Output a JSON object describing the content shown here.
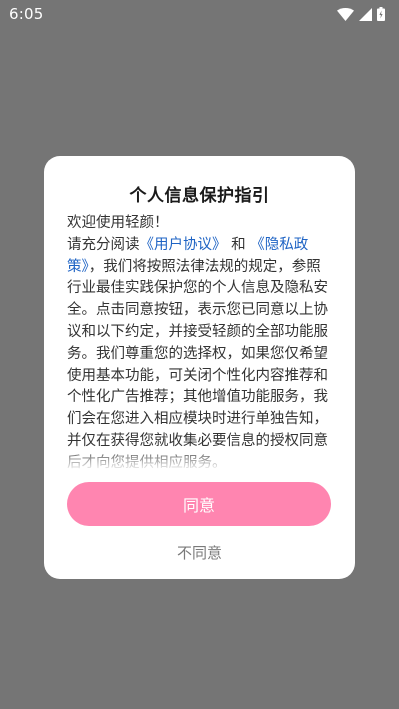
{
  "status_bar": {
    "time": "6:05",
    "icons": [
      "wifi-icon",
      "signal-icon",
      "battery-icon"
    ]
  },
  "dialog": {
    "title": "个人信息保护指引",
    "welcome": "欢迎使用轻颜！",
    "body_prefix": "请充分阅读",
    "user_agreement_link": "《用户协议》",
    "and_text": " 和 ",
    "privacy_policy_link": "《隐私政策》",
    "body_main": "，我们将按照法律法规的规定，参照行业最佳实践保护您的个人信息及隐私安全。点击同意按钮，表示您已同意以上协议和以下约定，并接受轻颜的全部功能服务。我们尊重您的选择权，如果您仅希望使用基本功能，可关闭个性化内容推荐和个性化广告推荐；其他增值功能服务，我们会在您进入相应模块时进行单独告知，并仅在获得您就收集必要信息的授权同意后才向您提供相应服务。",
    "agree_label": "同意",
    "disagree_label": "不同意"
  },
  "colors": {
    "overlay": "#757575",
    "agree_button": "#ff85b0",
    "link": "#1e63c4"
  }
}
